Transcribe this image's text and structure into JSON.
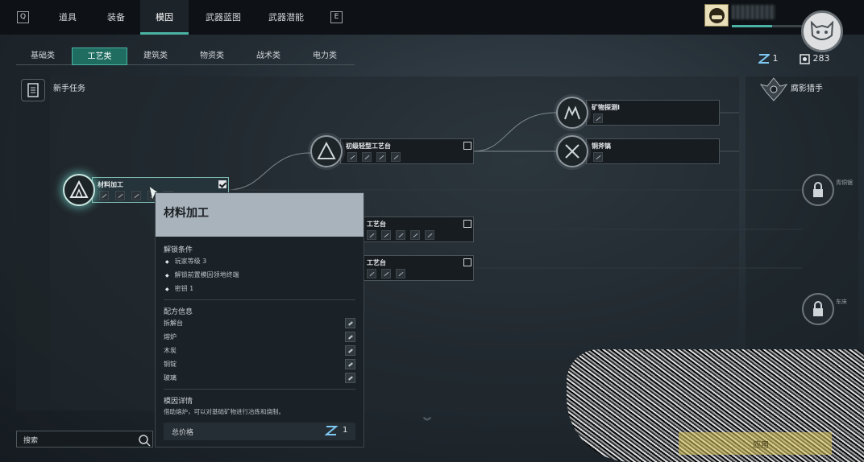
{
  "topbar": {
    "left_key": "Q",
    "right_key": "E",
    "tabs": [
      {
        "label": "道具",
        "active": false
      },
      {
        "label": "装备",
        "active": false
      },
      {
        "label": "模因",
        "active": true
      },
      {
        "label": "武器蓝图",
        "active": false
      },
      {
        "label": "武器潜能",
        "active": false
      }
    ]
  },
  "categories": [
    {
      "label": "基础类",
      "active": false
    },
    {
      "label": "工艺类",
      "active": true
    },
    {
      "label": "建筑类",
      "active": false
    },
    {
      "label": "物资类",
      "active": false
    },
    {
      "label": "战术类",
      "active": false
    },
    {
      "label": "电力类",
      "active": false
    }
  ],
  "currency": {
    "points": "1",
    "tokens": "283"
  },
  "left_column": {
    "label": "新手任务"
  },
  "right_column": {
    "label": "腐影猎手"
  },
  "nodes": {
    "material": {
      "title": "材料加工",
      "checked": true
    },
    "workbench": {
      "title": "初级轻型工艺台",
      "checked": false
    },
    "mid1": {
      "title": "工艺台",
      "checked": false
    },
    "mid2": {
      "title": "工艺台",
      "checked": false
    },
    "mineral": {
      "title": "矿物探测Ⅰ"
    },
    "axe": {
      "title": "铜斧镐"
    },
    "locked1": {
      "label": "青铜锯"
    },
    "locked2": {
      "label": "车床"
    }
  },
  "tooltip": {
    "title": "材料加工",
    "unlock_heading": "解锁条件",
    "conditions": [
      "玩家等级 3",
      "解锁前置模因领地终端",
      "密钥 1"
    ],
    "recipe_heading": "配方信息",
    "recipes": [
      "拆解台",
      "熔炉",
      "木炭",
      "铜锭",
      "玻璃"
    ],
    "detail_heading": "模因详情",
    "detail": "借助熔炉，可以对基础矿物进行冶炼和烧制。",
    "total_label": "总价格",
    "total_value": "1"
  },
  "search": {
    "placeholder": "搜索"
  },
  "apply_button": "应用",
  "colors": {
    "accent": "#4bb3a4",
    "tooltip_header": "#a9b3bb",
    "apply": "#dec85a"
  },
  "hud": {
    "xp_fraction": 0.55
  }
}
